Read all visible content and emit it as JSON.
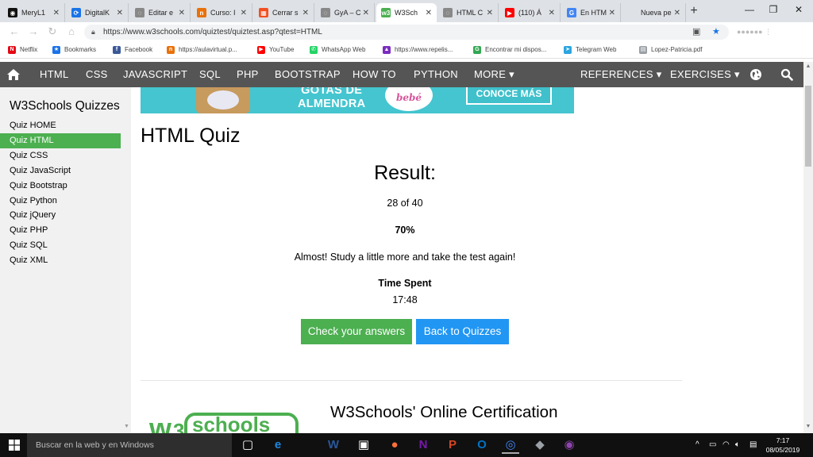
{
  "browser": {
    "tabs": [
      {
        "label": "MeryL1",
        "icon": "github-icon",
        "color": "#111111",
        "glyph": "◉"
      },
      {
        "label": "DigitalK",
        "icon": "spinner-icon",
        "color": "#1a73e8",
        "glyph": "⟳"
      },
      {
        "label": "Editar e",
        "icon": "globe-icon",
        "color": "#888888",
        "glyph": "◌"
      },
      {
        "label": "Curso: I",
        "icon": "course-icon",
        "color": "#e8710a",
        "glyph": "n"
      },
      {
        "label": "Cerrar s",
        "icon": "microsoft-icon",
        "color": "#f25022",
        "glyph": "▦"
      },
      {
        "label": "GyA – C",
        "icon": "globe-icon",
        "color": "#888888",
        "glyph": "◌"
      },
      {
        "label": "W3Sch",
        "icon": "w3schools-icon",
        "color": "#4CAF50",
        "glyph": "w3"
      },
      {
        "label": "HTML C",
        "icon": "globe-icon",
        "color": "#888888",
        "glyph": "◌"
      },
      {
        "label": "(110) Á",
        "icon": "youtube-icon",
        "color": "#ff0000",
        "glyph": "▶"
      },
      {
        "label": "En HTM",
        "icon": "google-icon",
        "color": "#4285f4",
        "glyph": "G"
      },
      {
        "label": "Nueva pest",
        "icon": "newtab-icon",
        "color": "#dee1e6",
        "glyph": ""
      }
    ],
    "new_tab_label": "+",
    "window_controls": {
      "minimize": "—",
      "restore": "❐",
      "close": "✕"
    },
    "address": {
      "url": "https://www.w3schools.com/quiztest/quiztest.asp?qtest=HTML"
    },
    "bookmarks": [
      {
        "label": "Netflix",
        "icon": "netflix-icon",
        "color": "#e50914",
        "glyph": "N"
      },
      {
        "label": "Bookmarks",
        "icon": "star-icon",
        "color": "#1a73e8",
        "glyph": "★"
      },
      {
        "label": "Facebook",
        "icon": "facebook-icon",
        "color": "#3b5998",
        "glyph": "f"
      },
      {
        "label": "https://aulavirtual.p...",
        "icon": "course-icon",
        "color": "#e8710a",
        "glyph": "n"
      },
      {
        "label": "YouTube",
        "icon": "youtube-icon",
        "color": "#ff0000",
        "glyph": "▶"
      },
      {
        "label": "WhatsApp Web",
        "icon": "whatsapp-icon",
        "color": "#25d366",
        "glyph": "✆"
      },
      {
        "label": "https://www.repelis...",
        "icon": "repelis-icon",
        "color": "#7b2cbf",
        "glyph": "▲"
      },
      {
        "label": "Encontrar mi dispos...",
        "icon": "find-device-icon",
        "color": "#34a853",
        "glyph": "G"
      },
      {
        "label": "Telegram Web",
        "icon": "telegram-icon",
        "color": "#2ca5e0",
        "glyph": "➤"
      },
      {
        "label": "Lopez-Patricia.pdf",
        "icon": "document-icon",
        "color": "#9aa0a6",
        "glyph": "▤"
      }
    ]
  },
  "topnav": {
    "items": [
      "HTML",
      "CSS",
      "JAVASCRIPT",
      "SQL",
      "PHP",
      "BOOTSTRAP",
      "HOW TO",
      "PYTHON",
      "MORE ▾"
    ],
    "references": "REFERENCES ▾",
    "exercises": "EXERCISES ▾"
  },
  "sidebar": {
    "title": "W3Schools Quizzes",
    "items": [
      "Quiz HOME",
      "Quiz HTML",
      "Quiz CSS",
      "Quiz JavaScript",
      "Quiz Bootstrap",
      "Quiz Python",
      "Quiz jQuery",
      "Quiz PHP",
      "Quiz SQL",
      "Quiz XML"
    ],
    "active_index": 1
  },
  "ad": {
    "line1": "GOTAS DE",
    "line2": "ALMENDRA",
    "brand": "bebé",
    "cta": "CONOCE MÁS"
  },
  "main": {
    "title": "HTML Quiz",
    "result_heading": "Result:",
    "score_text": "28 of 40",
    "percent": "70%",
    "message": "Almost! Study a little more and take the test again!",
    "time_label": "Time Spent",
    "time_value": "17:48",
    "check_button": "Check your answers",
    "back_button": "Back to Quizzes",
    "cert_title": "W3Schools' Online Certification",
    "colors": {
      "green": "#4CAF50",
      "blue": "#2196F3",
      "nav": "#555555"
    }
  },
  "taskbar": {
    "search_placeholder": "Buscar en la web y en Windows",
    "apps": [
      {
        "name": "task-view-icon",
        "color": "#ffffff"
      },
      {
        "name": "edge-icon",
        "color": "#1e88e5"
      },
      {
        "name": "word-icon",
        "color": "#2b579a"
      },
      {
        "name": "store-icon",
        "color": "#ffffff"
      },
      {
        "name": "firefox-icon",
        "color": "#ff7139"
      },
      {
        "name": "onenote-icon",
        "color": "#7719aa"
      },
      {
        "name": "powerpoint-icon",
        "color": "#d24726"
      },
      {
        "name": "outlook-icon",
        "color": "#0072c6"
      },
      {
        "name": "chrome-icon",
        "color": "#4285f4"
      },
      {
        "name": "app-icon",
        "color": "#9aa0a6"
      },
      {
        "name": "media-app-icon",
        "color": "#8e44ad"
      }
    ],
    "tray": {
      "chevron": "^"
    },
    "time": "7:17",
    "date": "08/05/2019"
  }
}
